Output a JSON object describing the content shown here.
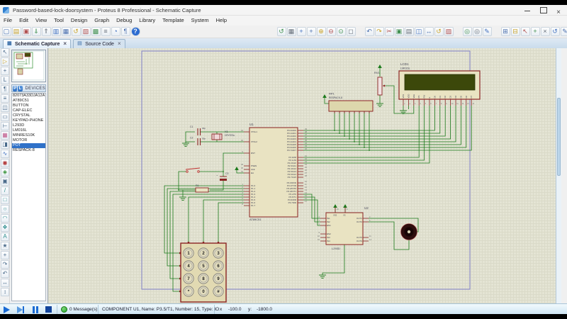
{
  "window": {
    "title": "Password-based-lock-doorsystem - Proteus 8 Professional - Schematic Capture"
  },
  "menu": {
    "items": [
      "File",
      "Edit",
      "View",
      "Tool",
      "Design",
      "Graph",
      "Debug",
      "Library",
      "Template",
      "System",
      "Help"
    ]
  },
  "toolbar": {
    "groups": [
      [
        "new-file",
        "open-folder",
        "save",
        "import-file",
        "export-file",
        "print",
        "print-area",
        "redraw-sheet",
        "view-logbook",
        "design-explorer",
        "bill-of-materials",
        "simulator-options",
        "text-notes",
        "help"
      ],
      [
        "refresh",
        "toggle-grid",
        "false-origin",
        "pan-center",
        "zoom-in",
        "zoom-out",
        "zoom-extents",
        "zoom-area"
      ],
      [
        "undo",
        "redo",
        "cut",
        "copy",
        "paste",
        "block-copy",
        "block-move",
        "block-rotate",
        "block-delete"
      ],
      [
        "pick-parts",
        "search-tag",
        "property-assignment"
      ],
      [
        "new-root-sheet",
        "remove-sheet",
        "goto-sheet",
        "add-part",
        "delete-part",
        "previous-sheet",
        "edit-script"
      ]
    ]
  },
  "tabs": [
    {
      "label": "Schematic Capture"
    },
    {
      "label": "Source Code"
    }
  ],
  "side_toolbar": {
    "icons": [
      "selection-mode",
      "component-mode",
      "junction-dot-mode",
      "wire-label-mode",
      "text-script-mode",
      "buses-mode",
      "subcircuit-mode",
      "terminals-mode",
      "device-pins-mode",
      "graph-mode",
      "tape-recorder-mode",
      "generator-mode",
      "voltage-probe-mode",
      "current-probe-mode",
      "virtual-instruments-mode",
      "2d-line-mode",
      "2d-box-mode",
      "2d-circle-mode",
      "2d-arc-mode",
      "2d-path-mode",
      "2d-text-mode",
      "2d-symbols-mode",
      "2d-markers-mode",
      "rotate-clockwise",
      "rotate-anticlockwise",
      "x-mirror",
      "y-mirror"
    ]
  },
  "object_selector": {
    "p_button": "P",
    "l_button": "L",
    "title": "DEVICES",
    "selected": "POT",
    "devices": [
      "82073A33DJA12A",
      "AT89C51",
      "BUTTON",
      "CAP-ELEC",
      "CRYSTAL",
      "KEYPAD-PHONE",
      "L293D",
      "LM016L",
      "MINRES10K",
      "MOTOR",
      "POT",
      "RESPACK-8"
    ]
  },
  "schematic": {
    "u1": {
      "ref": "U1",
      "value": "AT89C51",
      "left_pins": [
        "XTAL1",
        "XTAL2",
        "RST",
        "PSEN",
        "ALE",
        "EA",
        "P1.0",
        "P1.1",
        "P1.2",
        "P1.3",
        "P1.4",
        "P1.5",
        "P1.6",
        "P1.7"
      ],
      "left_nums": [
        "19",
        "18",
        "9",
        "29",
        "30",
        "31",
        "1",
        "2",
        "3",
        "4",
        "5",
        "6",
        "7",
        "8"
      ],
      "right_pins": [
        "P0.0/AD0",
        "P0.1/AD1",
        "P0.2/AD2",
        "P0.3/AD3",
        "P0.4/AD4",
        "P0.5/AD5",
        "P0.6/AD6",
        "P0.7/AD7",
        "P2.0/A8",
        "P2.1/A9",
        "P2.2/A10",
        "P2.3/A11",
        "P2.4/A12",
        "P2.5/A13",
        "P2.6/A14",
        "P2.7/A15",
        "P3.0/RXD",
        "P3.1/TXD",
        "P3.2/INT0",
        "P3.3/INT1",
        "P3.4/T0",
        "P3.5/T1",
        "P3.6/WR",
        "P3.7/RD"
      ],
      "right_nums": [
        "39",
        "38",
        "37",
        "36",
        "35",
        "34",
        "33",
        "32",
        "21",
        "22",
        "23",
        "24",
        "25",
        "26",
        "27",
        "28",
        "10",
        "11",
        "12",
        "13",
        "14",
        "15",
        "16",
        "17"
      ]
    },
    "lcd": {
      "ref": "LCD1",
      "value": "LM016L",
      "pins": [
        "VSS",
        "VDD",
        "VEE",
        "RS",
        "RW",
        "E",
        "D0",
        "D1",
        "D2",
        "D3",
        "D4",
        "D5",
        "D6",
        "D7"
      ],
      "nums": [
        "1",
        "2",
        "3",
        "4",
        "5",
        "6",
        "7",
        "8",
        "9",
        "10",
        "11",
        "12",
        "13",
        "14"
      ]
    },
    "rp1": {
      "ref": "RP1",
      "value": "RESPACK-8"
    },
    "rv1": {
      "ref": "RV1"
    },
    "x1": {
      "ref": "X1",
      "value": "CRYSTAL"
    },
    "c1": {
      "ref": "C1",
      "value": "30p"
    },
    "c2": {
      "ref": "C2",
      "value": "30p"
    },
    "c3": {
      "ref": "C3"
    },
    "r1": {
      "ref": "R1"
    },
    "u2": {
      "ref": "U2",
      "value": "L293D",
      "left_pins": [
        "IN1",
        "IN2",
        "EN1",
        "EN2",
        "IN3",
        "IN4"
      ],
      "left_nums": [
        "2",
        "7",
        "1",
        "9",
        "10",
        "15"
      ],
      "right_pins": [
        "OUT1",
        "OUT2",
        "OUT3",
        "OUT4"
      ],
      "right_nums": [
        "3",
        "6",
        "11",
        "14"
      ],
      "top_pins": [
        "VSS",
        "VS"
      ],
      "top_nums": [
        "16",
        "8"
      ]
    },
    "keypad": {
      "keys": [
        "1",
        "2",
        "3",
        "4",
        "5",
        "6",
        "7",
        "8",
        "9",
        "*",
        "0",
        "#"
      ]
    }
  },
  "status_bar": {
    "message_count": "0 Message(s)",
    "component_info": "COMPONENT U1, Name: P3.5/T1, Number: 15, Type: IO",
    "x_label": "x",
    "x_value": "-100.0",
    "y_label": "y:",
    "y_value": "-1800.0"
  }
}
